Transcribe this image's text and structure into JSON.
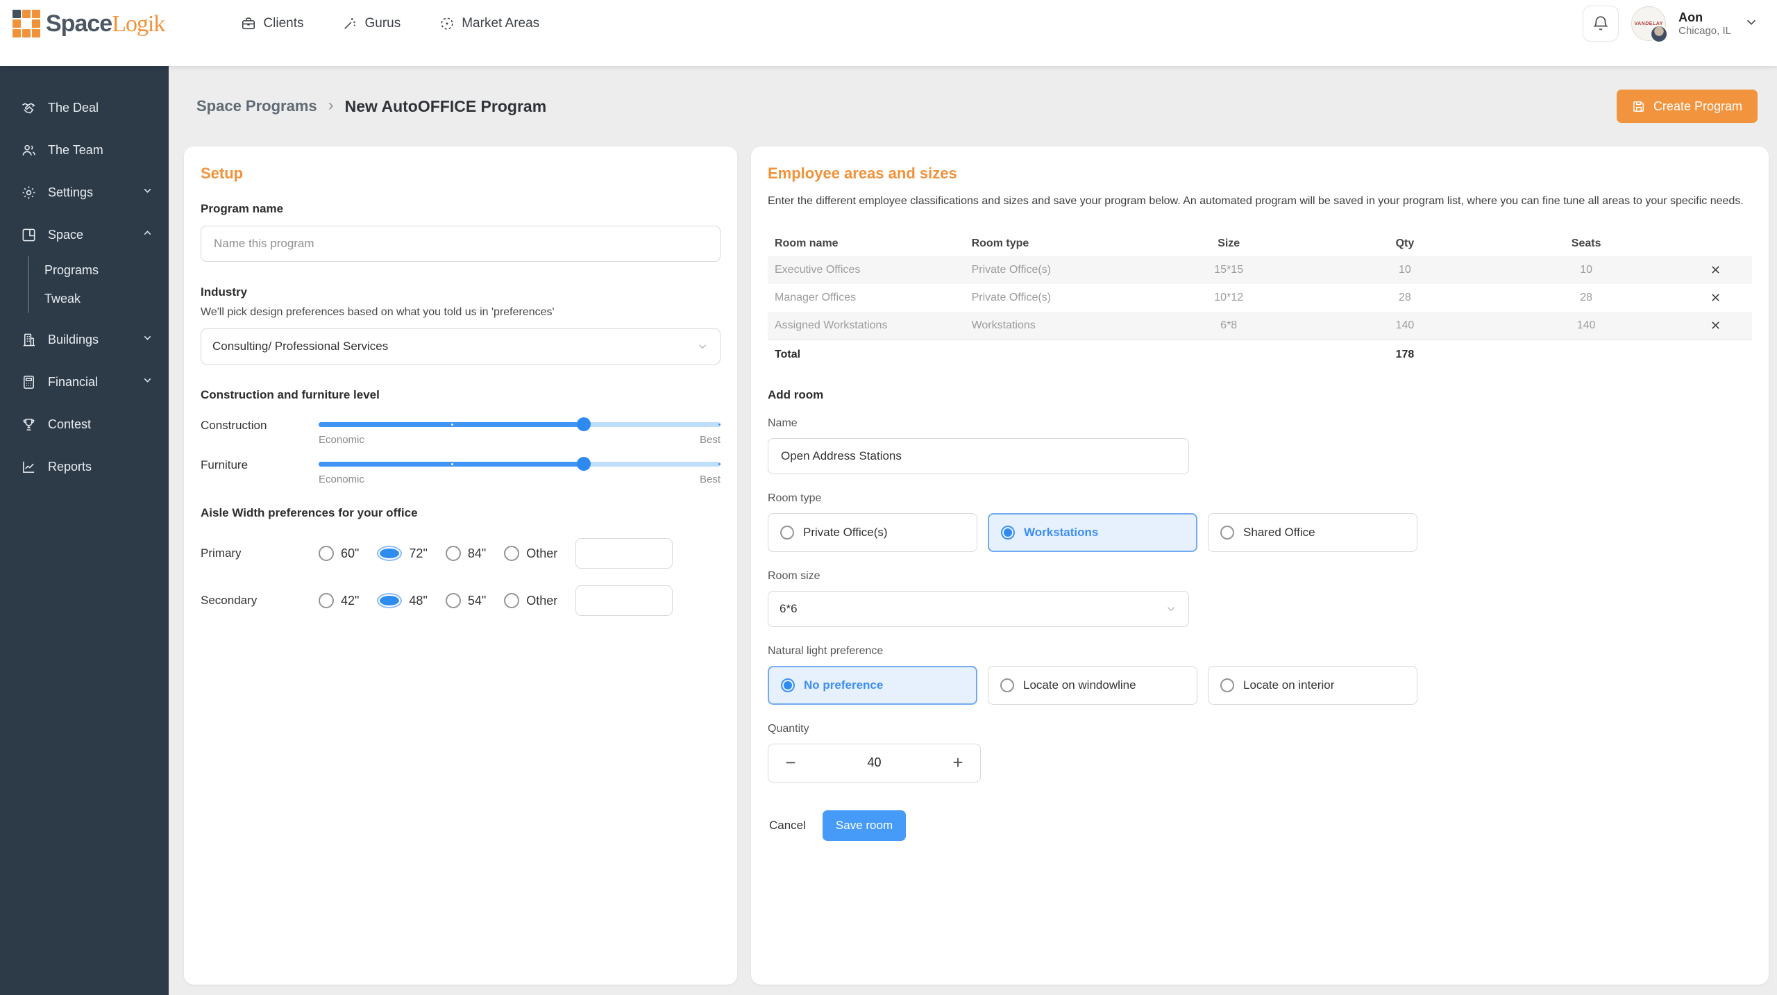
{
  "brand": {
    "word1": "Space",
    "word2": "Logik"
  },
  "header": {
    "nav": [
      {
        "label": "Clients"
      },
      {
        "label": "Gurus"
      },
      {
        "label": "Market Areas"
      }
    ],
    "user": {
      "company": "Aon",
      "location": "Chicago, IL",
      "avatar_text": "VANDELAY"
    }
  },
  "sidebar": {
    "items": [
      {
        "label": "The Deal"
      },
      {
        "label": "The Team"
      },
      {
        "label": "Settings"
      },
      {
        "label": "Space"
      },
      {
        "label": "Programs"
      },
      {
        "label": "Tweak"
      },
      {
        "label": "Buildings"
      },
      {
        "label": "Financial"
      },
      {
        "label": "Contest"
      },
      {
        "label": "Reports"
      }
    ]
  },
  "breadcrumb": {
    "parent": "Space Programs",
    "separator": "›",
    "current": "New AutoOFFICE Program"
  },
  "toolbar": {
    "create_label": "Create Program"
  },
  "setup": {
    "title": "Setup",
    "program_name": {
      "label": "Program name",
      "placeholder": "Name this program"
    },
    "industry": {
      "label": "Industry",
      "help": "We'll pick design preferences based on what you told us in 'preferences'",
      "value": "Consulting/ Professional Services"
    },
    "level": {
      "heading": "Construction and furniture level",
      "sliders": [
        {
          "label": "Construction",
          "min_label": "Economic",
          "max_label": "Best"
        },
        {
          "label": "Furniture",
          "min_label": "Economic",
          "max_label": "Best"
        }
      ]
    },
    "aisle": {
      "heading": "Aisle Width preferences for your office",
      "rows": [
        {
          "label": "Primary",
          "options": [
            "60\"",
            "72\"",
            "84\"",
            "Other"
          ],
          "selected": "72\""
        },
        {
          "label": "Secondary",
          "options": [
            "42\"",
            "48\"",
            "54\"",
            "Other"
          ],
          "selected": "48\""
        }
      ]
    }
  },
  "employee_areas": {
    "title": "Employee areas and sizes",
    "description": "Enter the different employee classifications and sizes and save your program below. An automated program will be saved in your program list, where you can fine tune all areas to your specific needs.",
    "table": {
      "headers": [
        "Room name",
        "Room type",
        "Size",
        "Qty",
        "Seats"
      ],
      "rows": [
        {
          "name": "Executive Offices",
          "type": "Private Office(s)",
          "size": "15*15",
          "qty": "10",
          "seats": "10"
        },
        {
          "name": "Manager Offices",
          "type": "Private Office(s)",
          "size": "10*12",
          "qty": "28",
          "seats": "28"
        },
        {
          "name": "Assigned Workstations",
          "type": "Workstations",
          "size": "6*8",
          "qty": "140",
          "seats": "140"
        }
      ],
      "total_label": "Total",
      "total_qty": "178"
    }
  },
  "add_room": {
    "heading": "Add room",
    "name": {
      "label": "Name",
      "value": "Open Address Stations"
    },
    "room_type": {
      "label": "Room type",
      "options": [
        "Private Office(s)",
        "Workstations",
        "Shared Office"
      ],
      "selected": "Workstations"
    },
    "room_size": {
      "label": "Room size",
      "value": "6*6"
    },
    "light": {
      "label": "Natural light preference",
      "options": [
        "No preference",
        "Locate on windowline",
        "Locate on interior"
      ],
      "selected": "No preference"
    },
    "quantity": {
      "label": "Quantity",
      "value": "40",
      "minus": "−",
      "plus": "+"
    },
    "cancel_label": "Cancel",
    "save_label": "Save room"
  },
  "colors": {
    "accent_orange": "#f0923a",
    "accent_blue": "#3d8ef3",
    "sidebar_bg": "#2d3b49"
  }
}
